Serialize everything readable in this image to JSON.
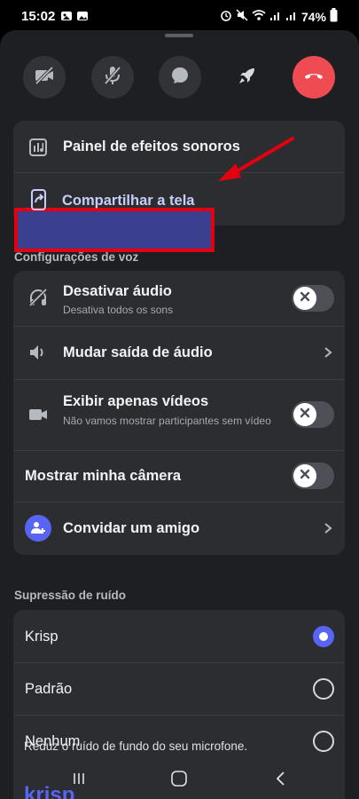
{
  "status": {
    "time": "15:02",
    "battery": "74%"
  },
  "top_controls": {
    "camera": "camera-off",
    "mic": "mic-off",
    "chat": "chat",
    "activities": "rocket",
    "end_call": "phone-hangup",
    "end_color": "#ee4c52"
  },
  "actions": {
    "soundboard": "Painel de efeitos sonoros",
    "share_screen": "Compartilhar a tela"
  },
  "voice_settings": {
    "heading": "Configurações de voz",
    "mute_title": "Desativar áudio",
    "mute_sub": "Desativa todos os sons",
    "output_title": "Mudar saída de áudio",
    "videos_title": "Exibir apenas vídeos",
    "videos_sub": "Não vamos mostrar participantes sem vídeo",
    "camera_title": "Mostrar minha câmera",
    "invite_title": "Convidar um amigo"
  },
  "noise": {
    "heading": "Supressão de ruído",
    "options": [
      "Krisp",
      "Padrão",
      "Nenhum"
    ],
    "selected": "Krisp",
    "note": "Reduz o ruído de fundo do seu microfone.",
    "brand": "krisp"
  },
  "colors": {
    "accent": "#5865f2",
    "highlight_border": "#e4000f"
  }
}
